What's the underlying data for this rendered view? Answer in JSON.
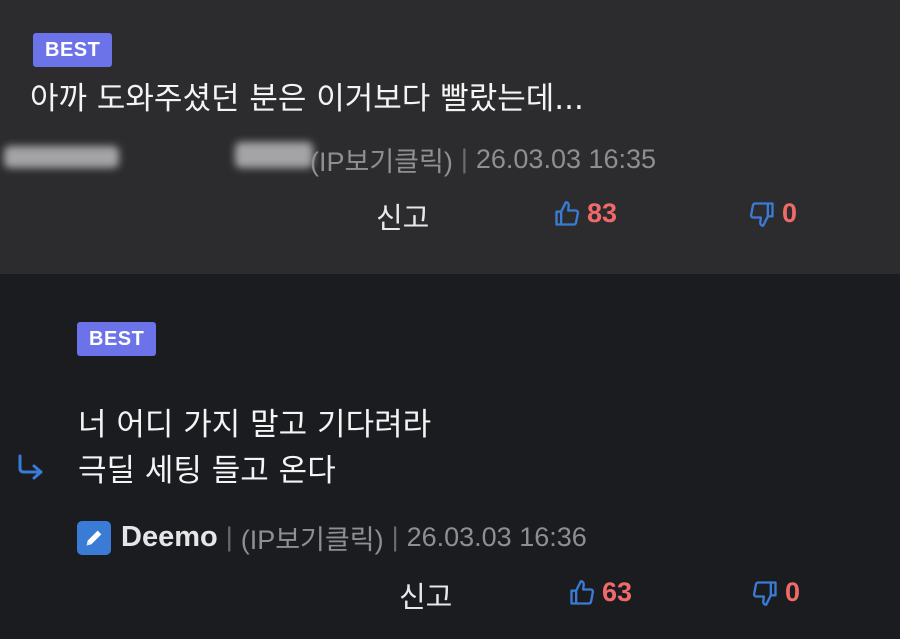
{
  "comments": [
    {
      "badge": "BEST",
      "text": "아까 도와주셨던 분은 이거보다 빨랐는데...",
      "author_visible": "",
      "ip_label": "(IP보기클릭)",
      "separator": "|",
      "timestamp": "26.03.03 16:35",
      "report_label": "신고",
      "upvotes": "83",
      "downvotes": "0"
    },
    {
      "badge": "BEST",
      "text": "너 어디 가지 말고 기다려라\n극딜 세팅 들고 온다",
      "author": "Deemo",
      "ip_label": "(IP보기클릭)",
      "separator": "|",
      "timestamp": "26.03.03 16:36",
      "report_label": "신고",
      "upvotes": "63",
      "downvotes": "0"
    }
  ],
  "colors": {
    "badge": "#6c72e8",
    "accent_blue": "#3a7bd5",
    "vote_count": "#f06a6a",
    "meta_gray": "#8e8f93"
  },
  "icons": [
    "thumbs-up-icon",
    "thumbs-down-icon",
    "pencil-icon",
    "reply-arrow-icon"
  ]
}
